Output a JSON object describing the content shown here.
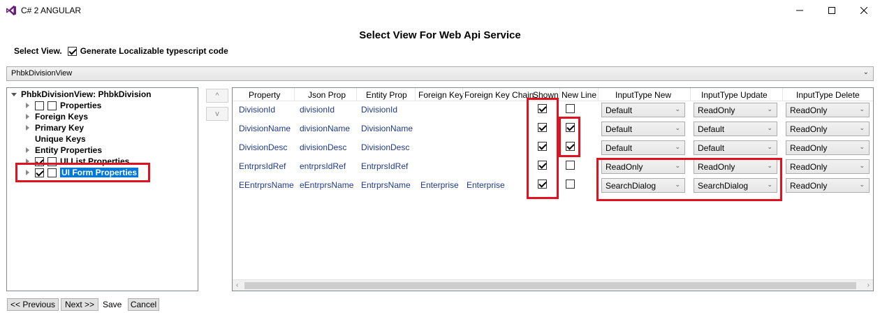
{
  "window": {
    "title": "C# 2 ANGULAR",
    "icon": "visual-studio-icon"
  },
  "heading": "Select View For Web Api Service",
  "select_view": {
    "label": "Select View.",
    "localizable_label": "Generate Localizable typescript code",
    "localizable_checked": true
  },
  "view_combo": {
    "value": "PhbkDivisionView"
  },
  "tree": {
    "root": "PhbkDivisionView: PhbkDivision",
    "items": [
      {
        "label": "Properties"
      },
      {
        "label": "Foreign Keys"
      },
      {
        "label": "Primary Key"
      },
      {
        "label": "Unique Keys"
      },
      {
        "label": "Entity Properties"
      },
      {
        "label": "UI List Properties"
      },
      {
        "label": "UI Form Properties"
      }
    ]
  },
  "updown": {
    "up": "^",
    "down": "v"
  },
  "grid": {
    "columns": [
      "Property",
      "Json Prop",
      "Entity Prop",
      "Foreign Key",
      "Foreign Key Chain",
      "Shown",
      "New Line",
      "InputType New",
      "InputType Update",
      "InputType Delete"
    ],
    "rows": [
      {
        "property": "DivisionId",
        "json": "divisionId",
        "entity": "DivisionId",
        "fk": "",
        "fk_chain": "",
        "shown": true,
        "new_line": false,
        "input_new": "Default",
        "input_update": "ReadOnly",
        "input_delete": "ReadOnly"
      },
      {
        "property": "DivisionName",
        "json": "divisionName",
        "entity": "DivisionName",
        "fk": "",
        "fk_chain": "",
        "shown": true,
        "new_line": true,
        "input_new": "Default",
        "input_update": "Default",
        "input_delete": "ReadOnly"
      },
      {
        "property": "DivisionDesc",
        "json": "divisionDesc",
        "entity": "DivisionDesc",
        "fk": "",
        "fk_chain": "",
        "shown": true,
        "new_line": true,
        "input_new": "Default",
        "input_update": "Default",
        "input_delete": "ReadOnly"
      },
      {
        "property": "EntrprsIdRef",
        "json": "entrprsIdRef",
        "entity": "EntrprsIdRef",
        "fk": "",
        "fk_chain": "",
        "shown": true,
        "new_line": false,
        "input_new": "ReadOnly",
        "input_update": "ReadOnly",
        "input_delete": "ReadOnly"
      },
      {
        "property": "EEntrprsName",
        "json": "eEntrprsName",
        "entity": "EntrprsName",
        "fk": "Enterprise",
        "fk_chain": "Enterprise",
        "shown": true,
        "new_line": false,
        "input_new": "SearchDialog",
        "input_update": "SearchDialog",
        "input_delete": "ReadOnly"
      }
    ]
  },
  "buttons": {
    "previous": "<< Previous",
    "next": "Next >>",
    "save": "Save",
    "cancel": "Cancel"
  },
  "colors": {
    "highlight": "#e0121f",
    "selection": "#0078d7",
    "link_text": "#1f3a8c"
  }
}
